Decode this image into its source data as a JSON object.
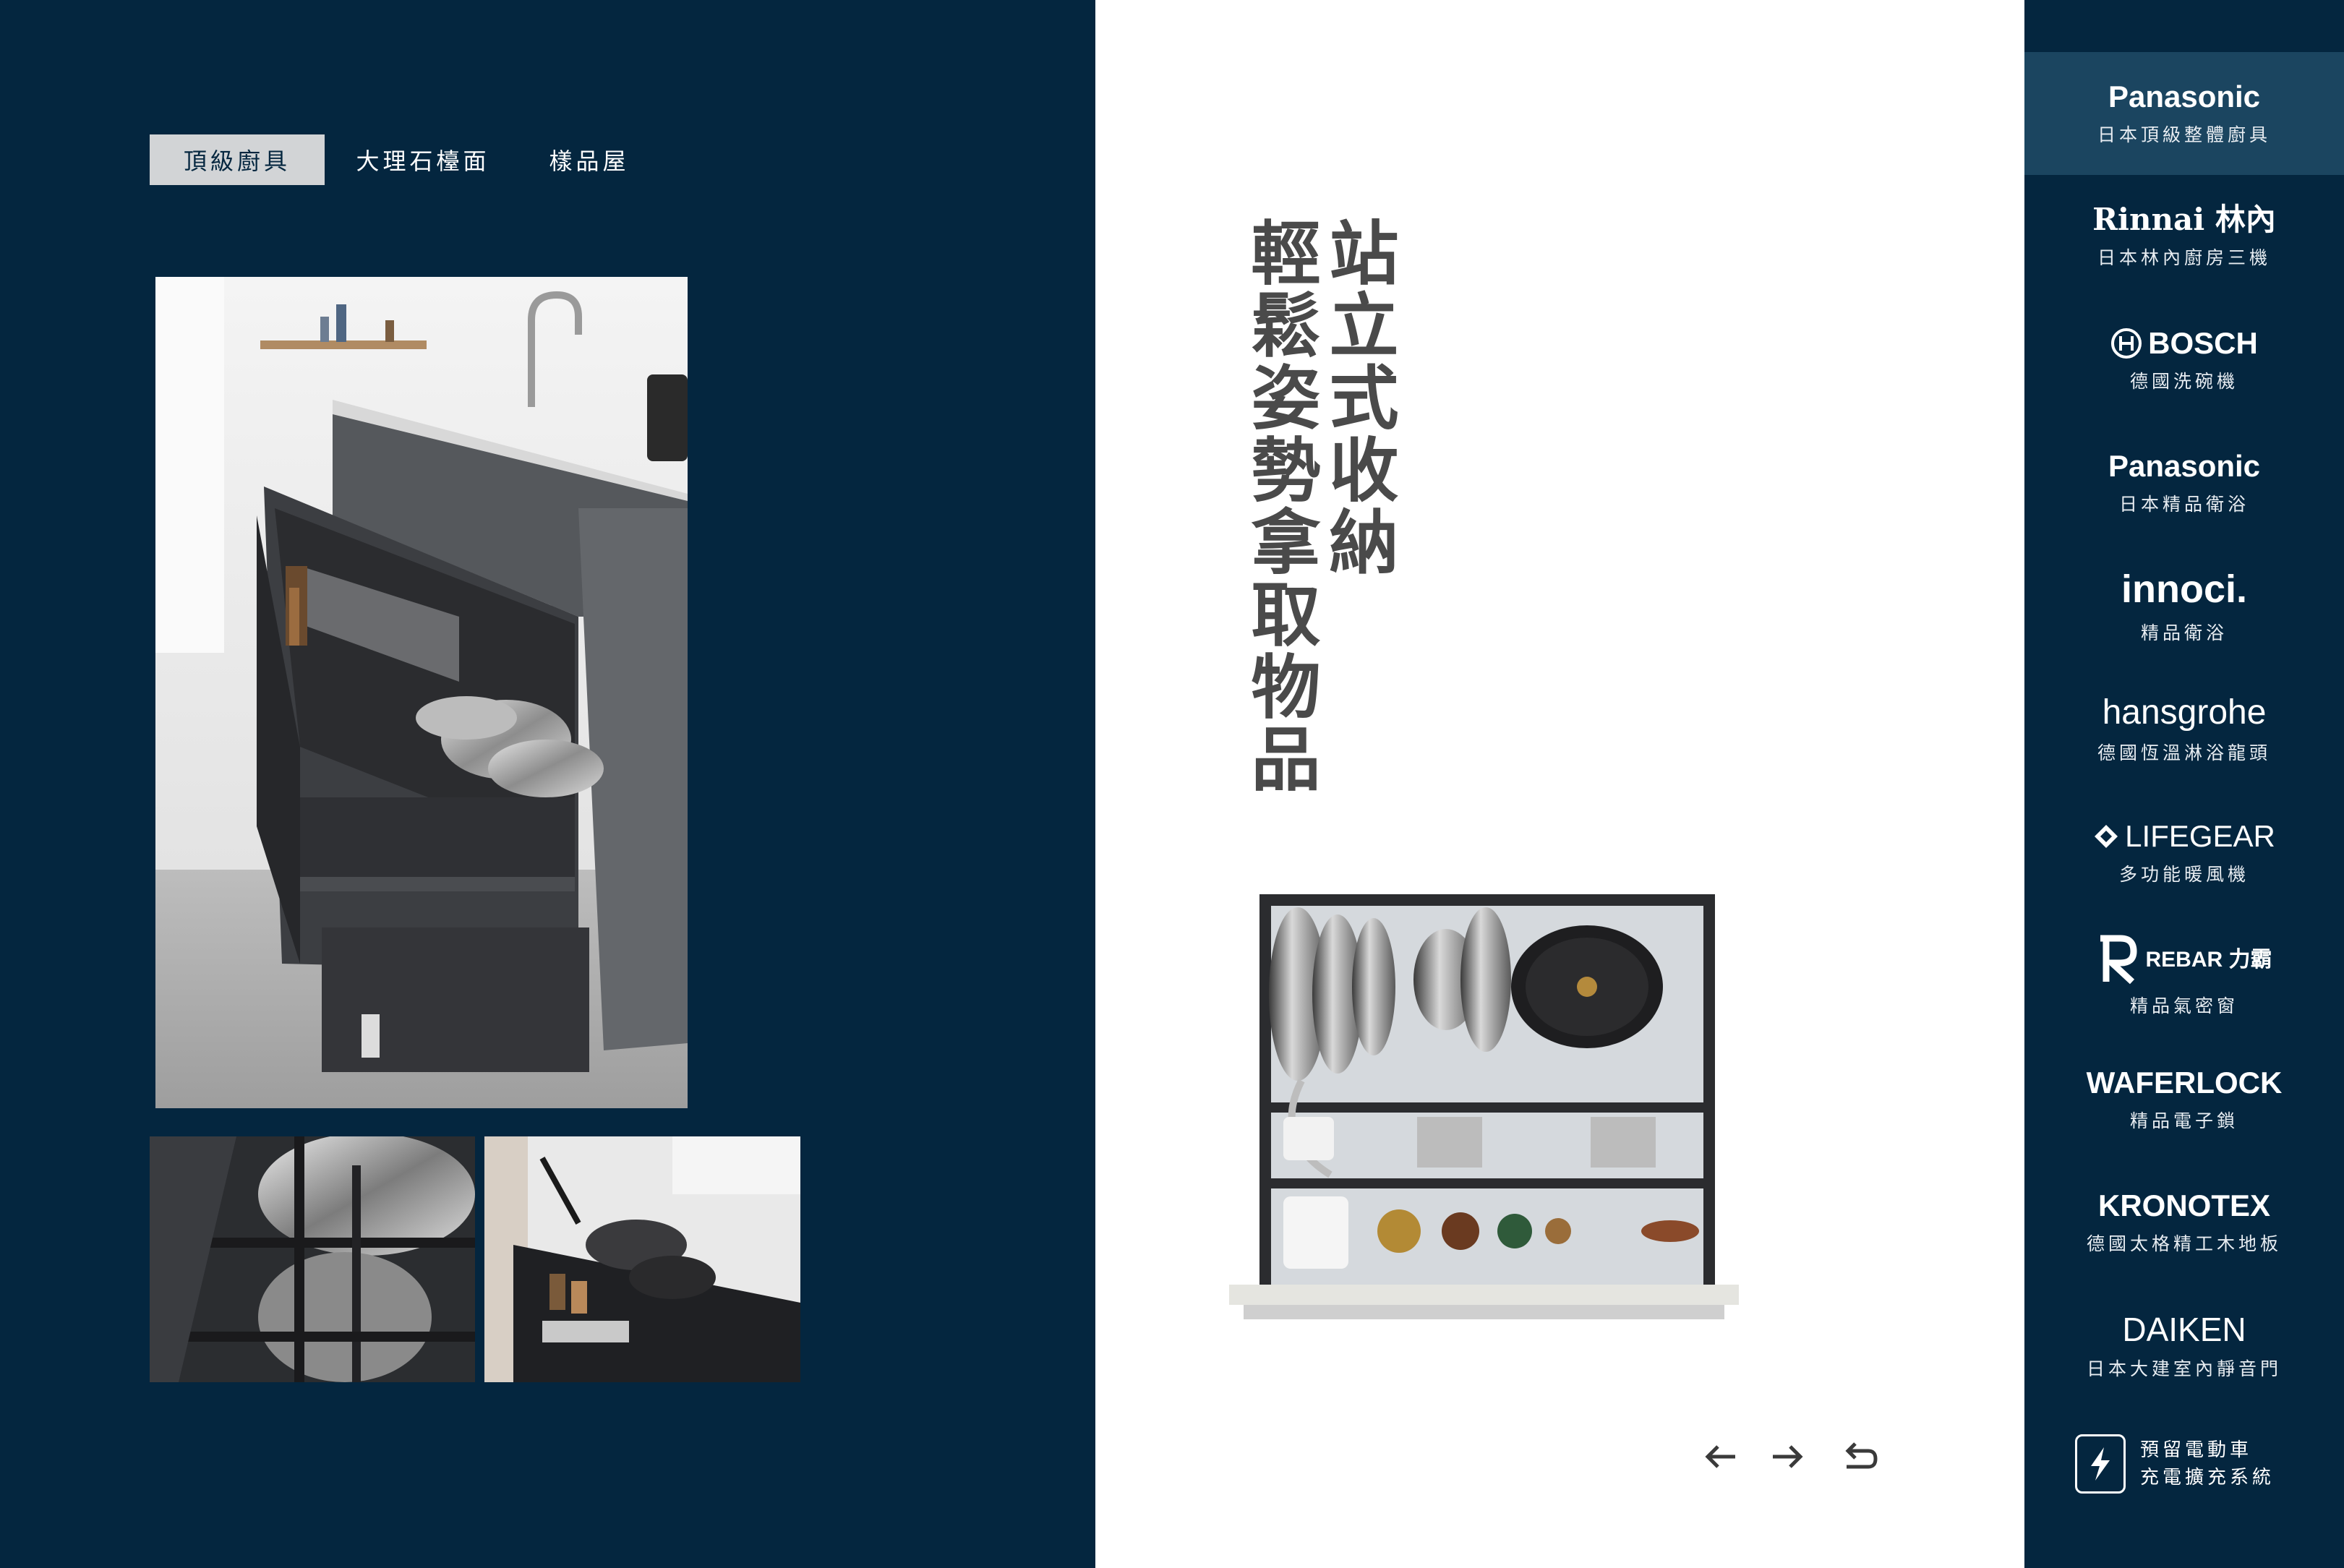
{
  "tabs": [
    {
      "label": "頂級廚具",
      "active": true
    },
    {
      "label": "大理石檯面",
      "active": false
    },
    {
      "label": "樣品屋",
      "active": false
    }
  ],
  "headline": {
    "line1": "站立式收納",
    "line2": "輕鬆姿勢拿取物品"
  },
  "nav": {
    "prev_icon": "arrow-left-icon",
    "next_icon": "arrow-right-icon",
    "back_icon": "return-icon"
  },
  "brands": [
    {
      "logo": "Panasonic",
      "subtitle": "日本頂級整體廚具",
      "active": true
    },
    {
      "logo": "Rinnai 林內",
      "subtitle": "日本林內廚房三機",
      "active": false
    },
    {
      "logo": "BOSCH",
      "subtitle": "德國洗碗機",
      "active": false
    },
    {
      "logo": "Panasonic",
      "subtitle": "日本精品衛浴",
      "active": false
    },
    {
      "logo": "innoci.",
      "subtitle": "精品衛浴",
      "active": false
    },
    {
      "logo": "hansgrohe",
      "subtitle": "德國恆溫淋浴龍頭",
      "active": false
    },
    {
      "logo": "LIFEGEAR",
      "subtitle": "多功能暖風機",
      "active": false
    },
    {
      "logo": "REBAR 力霸",
      "subtitle": "精品氣密窗",
      "active": false
    },
    {
      "logo": "WAFERLOCK",
      "subtitle": "精品電子鎖",
      "active": false
    },
    {
      "logo": "KRONOTEX",
      "subtitle": "德國太格精工木地板",
      "active": false
    },
    {
      "logo": "DAIKEN",
      "subtitle": "日本大建室內靜音門",
      "active": false
    }
  ],
  "ev": {
    "icon": "lightning-icon",
    "line1": "預留電動車",
    "line2": "充電擴充系統"
  },
  "colors": {
    "navy": "#04263f",
    "active_brand": "#1b4560",
    "tab_active_bg": "#d2d4d6",
    "headline": "#4a4a4a"
  }
}
